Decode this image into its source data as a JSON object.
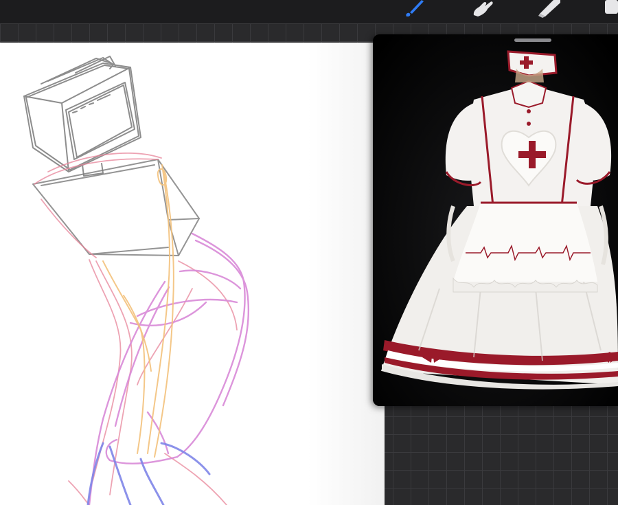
{
  "toolbar": {
    "tools": [
      {
        "name": "brush-tool",
        "active": true
      },
      {
        "name": "smudge-tool",
        "active": false
      },
      {
        "name": "eraser-tool",
        "active": false
      },
      {
        "name": "layers-tool",
        "active": false
      }
    ],
    "accent_color": "#2f7cf6"
  },
  "canvas": {
    "content": "sketch",
    "stroke_colors": [
      "#7a7a7a",
      "#e8859a",
      "#d98ad8",
      "#f3c27c",
      "#7f86e8"
    ]
  },
  "reference": {
    "content": "photo",
    "colors": {
      "background": "#000000",
      "dress": "#f4f2f0",
      "trim": "#9a1a2a"
    }
  }
}
